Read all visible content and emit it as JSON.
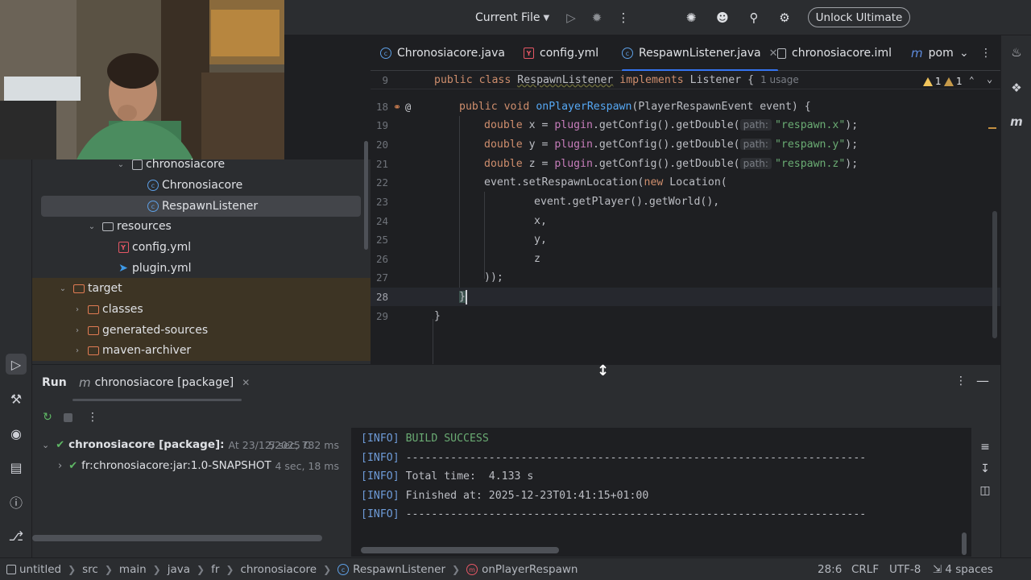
{
  "topbar": {
    "run_config": "Current File",
    "unlock_label": "Unlock Ultimate"
  },
  "project_tree": {
    "rows": [
      {
        "label": "chronosiacore",
        "kind": "package"
      },
      {
        "label": "Chronosiacore",
        "kind": "class"
      },
      {
        "label": "RespawnListener",
        "kind": "class"
      },
      {
        "label": "resources",
        "kind": "folder"
      },
      {
        "label": "config.yml",
        "kind": "yml"
      },
      {
        "label": "plugin.yml",
        "kind": "plugin"
      },
      {
        "label": "target",
        "kind": "excluded-folder"
      },
      {
        "label": "classes",
        "kind": "excluded-folder"
      },
      {
        "label": "generated-sources",
        "kind": "excluded-folder"
      },
      {
        "label": "maven-archiver",
        "kind": "excluded-folder"
      }
    ]
  },
  "tabs": [
    {
      "label": "Chronosiacore.java",
      "icon": "java-class-icon"
    },
    {
      "label": "config.yml",
      "icon": "yaml-icon"
    },
    {
      "label": "RespawnListener.java",
      "icon": "java-class-icon",
      "active": true
    },
    {
      "label": "chronosiacore.iml",
      "icon": "module-file-icon"
    },
    {
      "label": "pom",
      "icon": "maven-icon"
    }
  ],
  "editor": {
    "sticky": {
      "line": "9",
      "public": "public",
      "class": "class",
      "name": "RespawnListener",
      "implements": "implements",
      "iface": "Listener",
      "brace": "{",
      "usage": "1 usage"
    },
    "warnings": {
      "first": "1",
      "second": "1"
    },
    "hint_path": "path:",
    "lines": {
      "l18": {
        "num": "18",
        "p1": "public",
        "p2": "void",
        "fn": "onPlayerRespawn",
        "rest": "(PlayerRespawnEvent event) {"
      },
      "l19": {
        "num": "19",
        "type": "double",
        "var": " x = ",
        "field": "plugin",
        "call": ".getConfig().getDouble(",
        "str": "\"respawn.x\"",
        "end": ");"
      },
      "l20": {
        "num": "20",
        "type": "double",
        "var": " y = ",
        "field": "plugin",
        "call": ".getConfig().getDouble(",
        "str": "\"respawn.y\"",
        "end": ");"
      },
      "l21": {
        "num": "21",
        "type": "double",
        "var": " z = ",
        "field": "plugin",
        "call": ".getConfig().getDouble(",
        "str": "\"respawn.z\"",
        "end": ");"
      },
      "l22": {
        "num": "22",
        "pre": "event.setRespawnLocation(",
        "kw": "new",
        "post": " Location("
      },
      "l23": {
        "num": "23",
        "text": "event.getPlayer().getWorld(),"
      },
      "l24": {
        "num": "24",
        "text": "x,"
      },
      "l25": {
        "num": "25",
        "text": "y,"
      },
      "l26": {
        "num": "26",
        "text": "z"
      },
      "l27": {
        "num": "27",
        "text": "));"
      },
      "l28": {
        "num": "28",
        "text": "}"
      },
      "l29": {
        "num": "29",
        "text": "}"
      }
    }
  },
  "run_panel": {
    "title": "Run",
    "tab_label": "chronosiacore [package]",
    "tree": {
      "root_label": "chronosiacore [package]:",
      "root_meta": "At 23/12/2025 C",
      "root_duration": "5 sec, 782 ms",
      "child_label": "fr:chronosiacore:jar:1.0-SNAPSHOT",
      "child_duration": "4 sec, 18 ms"
    },
    "console": [
      {
        "tag": "[INFO]",
        "text": " BUILD SUCCESS",
        "success": true
      },
      {
        "tag": "[INFO]",
        "text": " ------------------------------------------------------------------------"
      },
      {
        "tag": "[INFO]",
        "text": " Total time:  4.133 s"
      },
      {
        "tag": "[INFO]",
        "text": " Finished at: 2025-12-23T01:41:15+01:00"
      },
      {
        "tag": "[INFO]",
        "text": " ------------------------------------------------------------------------"
      }
    ]
  },
  "statusbar": {
    "crumbs": [
      "untitled",
      "src",
      "main",
      "java",
      "fr",
      "chronosiacore",
      "RespawnListener",
      "onPlayerRespawn"
    ],
    "position": "28:6",
    "line_sep": "CRLF",
    "encoding": "UTF-8",
    "indent": "4 spaces"
  },
  "colors": {
    "accent": "#3574f0",
    "success": "#5fb865",
    "warning": "#f2c55c"
  }
}
